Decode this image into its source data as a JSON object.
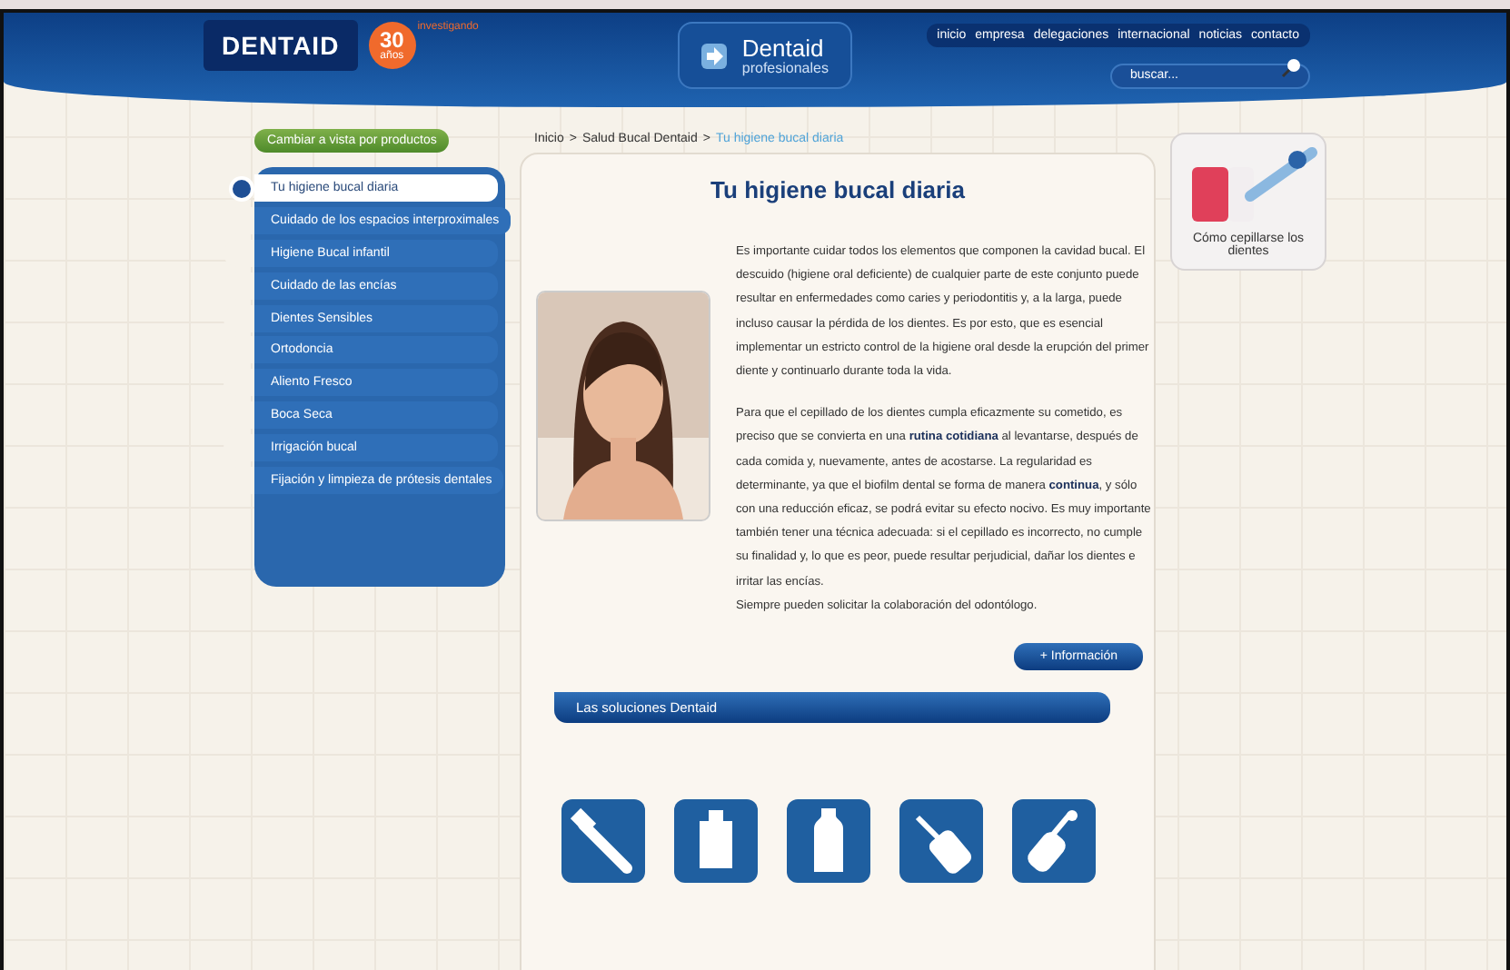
{
  "header": {
    "logo": "DENTAID",
    "badge": {
      "number": "30",
      "unit": "años",
      "arc_text": "investigando"
    },
    "pro_button": {
      "title": "Dentaid",
      "subtitle": "profesionales"
    },
    "nav": [
      "inicio",
      "empresa",
      "delegaciones",
      "internacional",
      "noticias",
      "contacto"
    ],
    "search": {
      "placeholder": "buscar..."
    }
  },
  "sidebar": {
    "switch_button": "Cambiar a vista por productos",
    "items": [
      {
        "label": "Tu higiene bucal diaria",
        "selected": true
      },
      {
        "label": "Cuidado de los espacios interproximales",
        "selected": false
      },
      {
        "label": "Higiene Bucal infantil",
        "selected": false
      },
      {
        "label": "Cuidado de las encías",
        "selected": false
      },
      {
        "label": "Dientes Sensibles",
        "selected": false
      },
      {
        "label": "Ortodoncia",
        "selected": false
      },
      {
        "label": "Aliento Fresco",
        "selected": false
      },
      {
        "label": "Boca Seca",
        "selected": false
      },
      {
        "label": "Irrigación bucal",
        "selected": false
      },
      {
        "label": "Fijación y limpieza de prótesis dentales",
        "selected": false
      }
    ]
  },
  "breadcrumb_separator": ">",
  "breadcrumb": [
    {
      "label": "Inicio",
      "current": false
    },
    {
      "label": "Salud Bucal Dentaid",
      "current": false
    },
    {
      "label": "Tu higiene bucal diaria",
      "current": true
    }
  ],
  "article": {
    "title": "Tu higiene bucal diaria",
    "paragraphs": [
      "Es importante cuidar todos los elementos que componen la cavidad bucal. El descuido (higiene oral deficiente) de cualquier parte de este conjunto puede resultar en enfermedades como caries y periodontitis y, a la larga, puede incluso causar la pérdida de los dientes. Es por esto, que es esencial implementar un estricto control de la higiene oral desde la erupción del primer diente y continuarlo durante toda la vida.",
      "Para que el cepillado de los dientes cumpla eficazmente su cometido, es preciso que se convierta en una **rutina cotidiana** al levantarse, después de cada comida y, nuevamente, antes de acostarse. La regularidad es determinante, ya que el biofilm dental se forma de manera **continua**, y sólo con una reducción eficaz, se podrá evitar su efecto nocivo. Es muy importante también tener una técnica adecuada: si el cepillado es incorrecto, no cumple su finalidad y, lo que es peor, puede resultar perjudicial, dañar los dientes e irritar las encías.",
      "Siempre pueden solicitar la colaboración del odontólogo."
    ],
    "more_button": "+ Información"
  },
  "solutions": {
    "title": "Las soluciones Dentaid",
    "products": [
      {
        "kind": "toothbrush"
      },
      {
        "kind": "tube"
      },
      {
        "kind": "bottle"
      },
      {
        "kind": "irrigator"
      },
      {
        "kind": "electric"
      }
    ]
  },
  "side_card": {
    "caption": "Cómo cepillarse los dientes"
  }
}
